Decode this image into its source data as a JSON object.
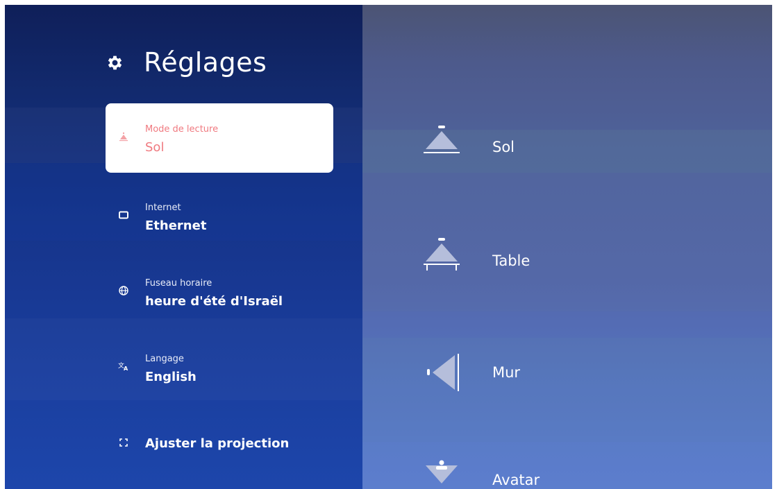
{
  "settings": {
    "title": "Réglages",
    "title_icon": "gear-icon"
  },
  "menu": [
    {
      "label": "Mode de lecture",
      "value": "Sol",
      "icon": "floor-projector-icon",
      "active": true
    },
    {
      "label": "Internet",
      "value": "Ethernet",
      "icon": "ethernet-icon",
      "active": false
    },
    {
      "label": "Fuseau horaire",
      "value": "heure d'été d'Israël",
      "icon": "globe-icon",
      "active": false
    },
    {
      "label": "Langage",
      "value": "English",
      "icon": "translate-icon",
      "active": false
    },
    {
      "label": "",
      "value": "Ajuster la projection",
      "icon": "adjust-projection-icon",
      "active": false
    }
  ],
  "modes": [
    {
      "label": "Sol",
      "icon": "floor-mode-icon"
    },
    {
      "label": "Table",
      "icon": "table-mode-icon"
    },
    {
      "label": "Mur",
      "icon": "wall-mode-icon"
    },
    {
      "label": "Avatar",
      "icon": "avatar-mode-icon"
    }
  ],
  "colors": {
    "active_text": "#f07a80",
    "left_panel": "#16348a",
    "right_panel": "#5266a6"
  }
}
